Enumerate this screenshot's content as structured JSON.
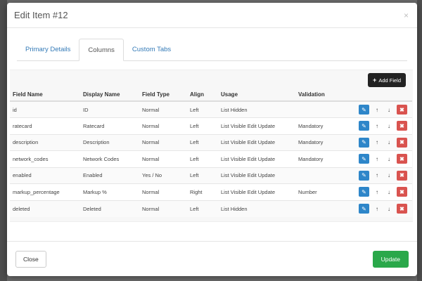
{
  "modal": {
    "title": "Edit Item #12",
    "close_glyph": "×"
  },
  "tabs": [
    {
      "label": "Primary Details",
      "active": false
    },
    {
      "label": "Columns",
      "active": true
    },
    {
      "label": "Custom Tabs",
      "active": false
    }
  ],
  "toolbar": {
    "add_field_label": "Add Field",
    "add_field_icon": "plus-icon"
  },
  "table": {
    "headers": [
      "Field Name",
      "Display Name",
      "Field Type",
      "Align",
      "Usage",
      "Validation"
    ],
    "rows": [
      {
        "field_name": "id",
        "display_name": "ID",
        "field_type": "Normal",
        "align": "Left",
        "usage": "List Hidden",
        "validation": ""
      },
      {
        "field_name": "ratecard",
        "display_name": "Ratecard",
        "field_type": "Normal",
        "align": "Left",
        "usage": "List Visible Edit Update",
        "validation": "Mandatory"
      },
      {
        "field_name": "description",
        "display_name": "Description",
        "field_type": "Normal",
        "align": "Left",
        "usage": "List Visible Edit Update",
        "validation": "Mandatory"
      },
      {
        "field_name": "network_codes",
        "display_name": "Network Codes",
        "field_type": "Normal",
        "align": "Left",
        "usage": "List Visible Edit Update",
        "validation": "Mandatory"
      },
      {
        "field_name": "enabled",
        "display_name": "Enabled",
        "field_type": "Yes / No",
        "align": "Left",
        "usage": "List Visible Edit Update",
        "validation": ""
      },
      {
        "field_name": "markup_percentage",
        "display_name": "Markup %",
        "field_type": "Normal",
        "align": "Right",
        "usage": "List Visible Edit Update",
        "validation": "Number"
      },
      {
        "field_name": "deleted",
        "display_name": "Deleted",
        "field_type": "Normal",
        "align": "Left",
        "usage": "List Hidden",
        "validation": ""
      }
    ]
  },
  "row_action_icons": [
    "edit-icon",
    "arrow-up-icon",
    "arrow-down-icon",
    "delete-icon"
  ],
  "footer": {
    "close_label": "Close",
    "update_label": "Update"
  },
  "colors": {
    "edit_button": "#2e86c9",
    "delete_button": "#d9534f",
    "update_button": "#2aa84a",
    "add_field_button": "#222222",
    "tab_link": "#337ab7"
  }
}
